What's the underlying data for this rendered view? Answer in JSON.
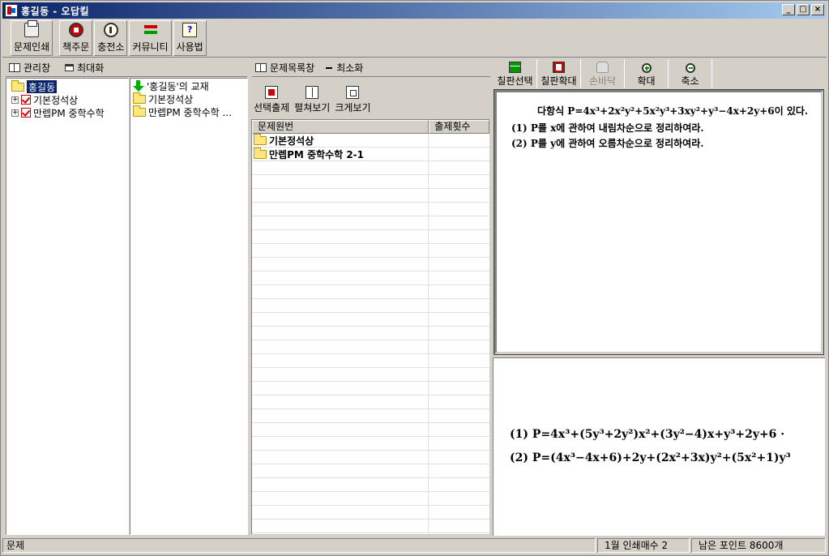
{
  "window": {
    "title": "홍길동 - 오답킬",
    "controls": [
      "_",
      "□",
      "×"
    ]
  },
  "toolbar": {
    "print": "문제인쇄",
    "order": "책주문",
    "charge": "충전소",
    "community": "커뮤니티",
    "help": "사용법"
  },
  "manager": {
    "title": "관리창",
    "maximize": "최대화",
    "tree": {
      "root": "홍길동",
      "books": [
        "기본정석상",
        "만렙PM 중학수학"
      ]
    },
    "books_header": "'홍길동'의 교재",
    "books": [
      "기본정석상",
      "만렙PM 중학수학 ..."
    ]
  },
  "problem_list": {
    "title": "문제목록창",
    "minimize": "최소화",
    "tools": {
      "select": "선택출제",
      "expand": "펼쳐보기",
      "large": "크게보기"
    },
    "columns": [
      "문제원번",
      "출제횟수"
    ],
    "rows": [
      {
        "name": "기본정석상",
        "count": ""
      },
      {
        "name": "만렙PM 중학수학 2-1",
        "count": ""
      }
    ]
  },
  "preview": {
    "tools": {
      "board_select": "칠판선택",
      "board_zoom": "칠판확대",
      "hand": "손바닥",
      "zoom_in": "확대",
      "zoom_out": "축소"
    },
    "question": {
      "line1": "다항식 P=4x³+2x²y²+5x²y³+3xy²+y³−4x+2y+6이 있다.",
      "line2": "(1) P를 x에 관하여 내림차순으로 정리하여라.",
      "line3": "(2) P를 y에 관하여 오름차순으로 정리하여라."
    },
    "answer": {
      "line1": "(1)  P=4x³+(5y³+2y²)x²+(3y²−4)x+y³+2y+6 ·",
      "line2": "(2)  P=(4x³−4x+6)+2y+(2x²+3x)y²+(5x²+1)y³"
    }
  },
  "status": {
    "left": "문제",
    "print_count": "1월 인쇄매수 2",
    "points": "남은 포인트 8600개"
  }
}
